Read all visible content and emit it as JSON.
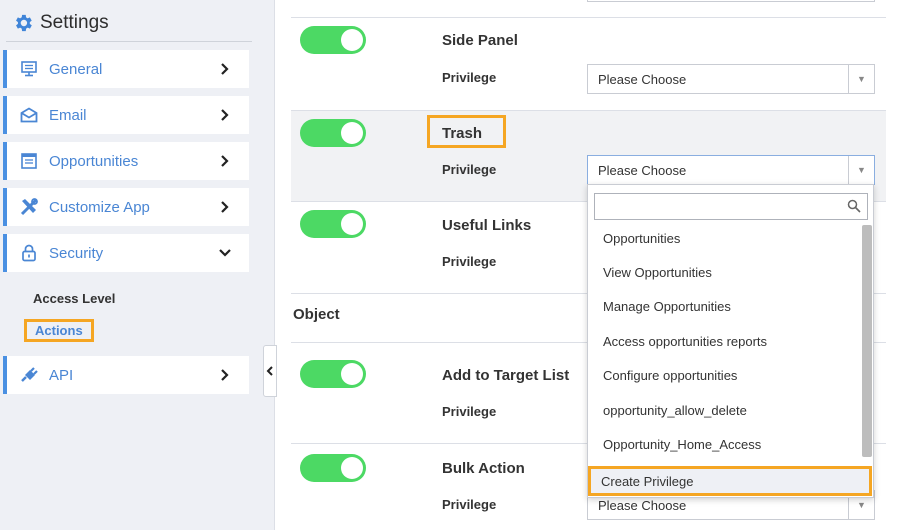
{
  "sidebar": {
    "title": "Settings",
    "items": [
      {
        "label": "General",
        "icon": "monitor-icon"
      },
      {
        "label": "Email",
        "icon": "envelope-icon"
      },
      {
        "label": "Opportunities",
        "icon": "list-icon"
      },
      {
        "label": "Customize App",
        "icon": "tools-icon"
      },
      {
        "label": "Security",
        "icon": "lock-icon"
      },
      {
        "label": "API",
        "icon": "plug-icon"
      }
    ],
    "security_sub": [
      "Access Level",
      "Actions"
    ],
    "accent_color": "#4a90e2"
  },
  "main": {
    "rows": [
      {
        "title": "Side Panel",
        "privilege_label": "Privilege",
        "select_value": "Please Choose",
        "enabled": true
      },
      {
        "title": "Trash",
        "privilege_label": "Privilege",
        "select_value": "Please Choose",
        "enabled": true
      },
      {
        "title": "Useful Links",
        "privilege_label": "Privilege",
        "enabled": true
      },
      {
        "title": "Add to Target List",
        "privilege_label": "Privilege",
        "enabled": true
      },
      {
        "title": "Bulk Action",
        "privilege_label": "Privilege",
        "select_value": "Please Choose",
        "enabled": true
      }
    ],
    "object_heading": "Object",
    "dropdown": {
      "options": [
        "Opportunities",
        "View Opportunities",
        "Manage Opportunities",
        "Access opportunities reports",
        "Configure opportunities",
        "opportunity_allow_delete",
        "Opportunity_Home_Access"
      ],
      "create_label": "Create Privilege"
    },
    "toggle_color": "#4cd964",
    "highlight_color": "#f5a623"
  }
}
